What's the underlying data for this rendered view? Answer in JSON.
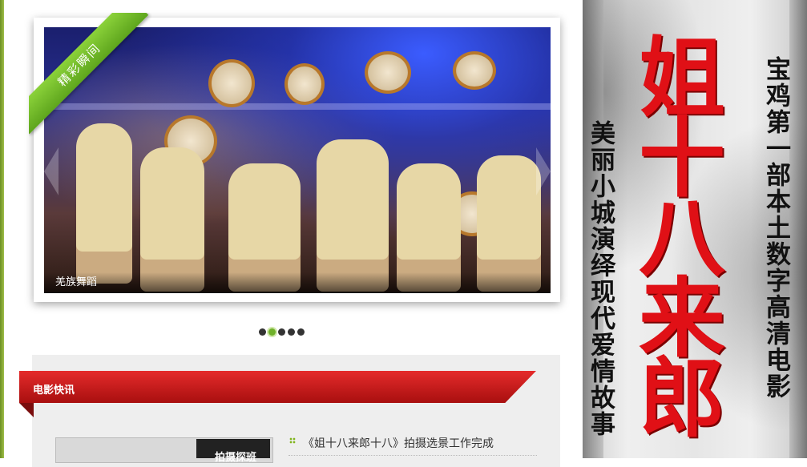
{
  "slider": {
    "badge": "精彩瞬间",
    "caption": "羌族舞蹈",
    "dots": [
      {
        "active": false
      },
      {
        "active": true
      },
      {
        "active": false
      },
      {
        "active": false
      },
      {
        "active": false
      }
    ]
  },
  "news": {
    "header": "电影快讯",
    "thumb_label": "拍摄探班",
    "items": [
      "《姐十八来郎十八》拍摄选景工作完成"
    ]
  },
  "poster": {
    "left_column": "美丽小城演绎现代爱情故事",
    "right_column": "宝鸡第一部本土数字高清电影",
    "title": "姐十八来郎"
  },
  "colors": {
    "ribbon_green": "#6fb82a",
    "header_red": "#d11b1b",
    "title_red": "#e01016"
  }
}
